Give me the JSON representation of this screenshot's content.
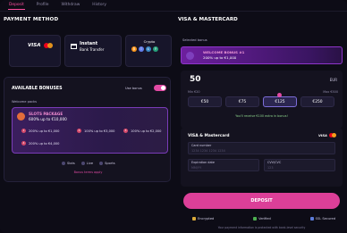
{
  "tabs": [
    {
      "label": "Deposit",
      "active": true
    },
    {
      "label": "Profile"
    },
    {
      "label": "Withdraw"
    },
    {
      "label": "History"
    }
  ],
  "left": {
    "title": "PAYMENT METHOD",
    "methods": {
      "card_label": "VISA",
      "bank_line1": "Instant",
      "bank_line2": "Bank Transfer",
      "crypto_label": "Crypto"
    },
    "bonuses": {
      "title": "AVAILABLE BONUSES",
      "use_bonus": "Use bonus",
      "welcome_label": "Welcome packs",
      "pack_name": "SLOTS PACKAGE",
      "pack_desc": "600% up to €10,000",
      "options": [
        "200% up to €1,000",
        "100% up to €3,000",
        "100% up to €2,000",
        "200% up to €4,000"
      ],
      "option_numbers": [
        "1",
        "2",
        "3",
        "4"
      ],
      "filters": [
        "Slots",
        "Live",
        "Sports"
      ],
      "terms": "Bonus terms apply"
    }
  },
  "right": {
    "title": "VISA & MASTERCARD",
    "selected_label": "Selected bonus",
    "welcome_name": "WELCOME BONUS #1",
    "welcome_desc": "200% up to €1,000",
    "amount": "50",
    "currency": "EUR",
    "min": "Min €20",
    "max": "Max €500",
    "chips": [
      "€50",
      "€75",
      "€125",
      "€250"
    ],
    "receive": "You'll receive €100 extra in bonus!",
    "card_form": {
      "title": "VISA & Mastercard",
      "card_number_label": "Card number",
      "card_number_placeholder": "1234 1234 1234 1234",
      "expiration_label": "Expiration date",
      "expiration_placeholder": "MM/YY",
      "cvv_label": "CVV/CVC",
      "cvv_placeholder": "123"
    },
    "deposit_button": "DEPOSIT",
    "badges": [
      "Encrypted",
      "Verified",
      "SSL Secured"
    ],
    "footer": "Your payment information is protected with bank-level security"
  },
  "colors": {
    "accent": "#e24aa4",
    "background": "#0d0c16",
    "panel": "#14121f"
  }
}
